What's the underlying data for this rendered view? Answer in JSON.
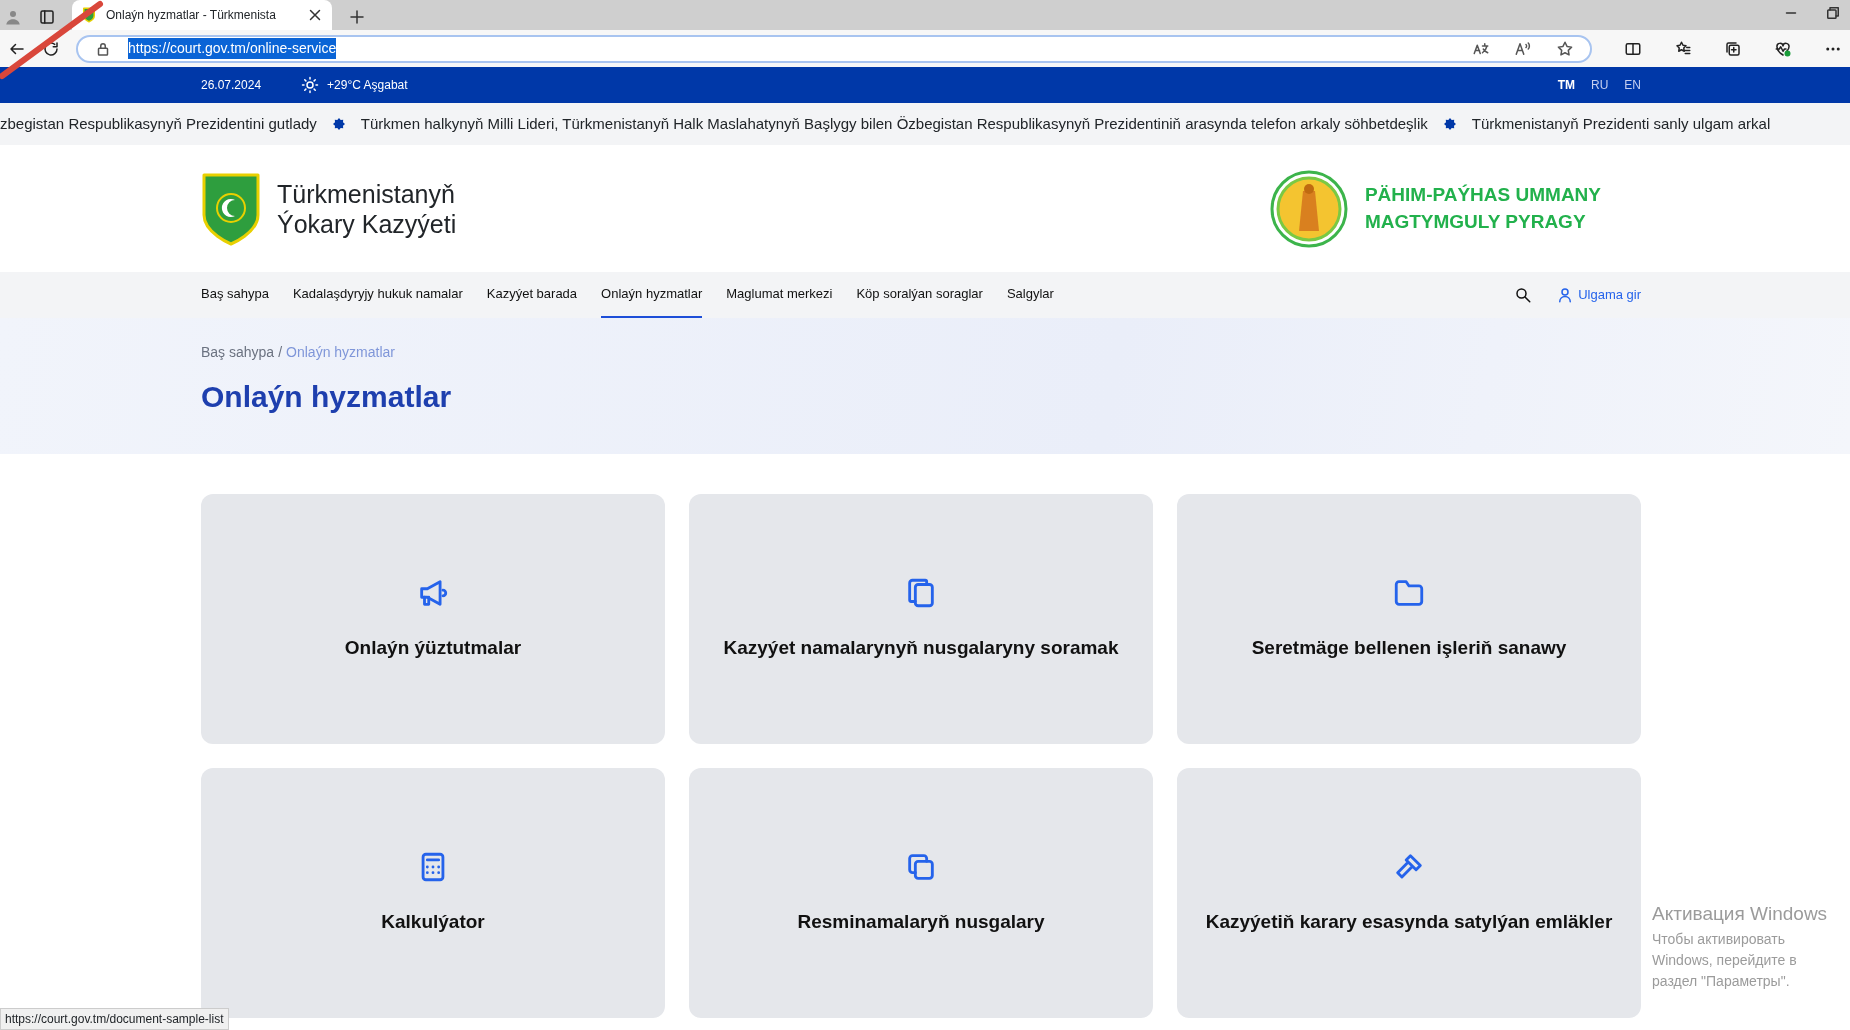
{
  "browser": {
    "tabs": [
      {
        "title": "Onlaýn hyzmatlar - Türkmenista",
        "selected": true
      }
    ],
    "url": "https://court.gov.tm/online-service",
    "url_highlighted": true
  },
  "topbar": {
    "date": "26.07.2024",
    "weather": "+29°C Aşgabat",
    "languages": [
      {
        "label": "TM",
        "selected": true
      },
      {
        "label": "RU",
        "selected": false
      },
      {
        "label": "EN",
        "selected": false
      }
    ]
  },
  "ticker": [
    "zbegistan Respublikasynyň Prezidentini gutlady",
    "Türkmen halkynyň Milli Lideri, Türkmenistanyň Halk Maslahatynyň Başlygy bilen Özbegistan Respublikasynyň Prezidentiniň arasynda telefon arkaly söhbetdeşlik",
    "Türkmenistanyň Prezidenti sanly ulgam arkal"
  ],
  "header": {
    "title_lines": [
      "Türkmenistanyň",
      "Ýokary Kazyýeti"
    ],
    "slogan_lines": [
      "PÄHIM-PAÝHAS UMMANY",
      "MAGTYMGULY PYRAGY"
    ]
  },
  "nav": {
    "items": [
      {
        "label": "Baş sahypa",
        "selected": false
      },
      {
        "label": "Kadalaşdyryjy hukuk namalar",
        "selected": false
      },
      {
        "label": "Kazyýet barada",
        "selected": false
      },
      {
        "label": "Onlaýn hyzmatlar",
        "selected": true
      },
      {
        "label": "Maglumat merkezi",
        "selected": false
      },
      {
        "label": "Köp soralýan soraglar",
        "selected": false
      },
      {
        "label": "Salgylar",
        "selected": false
      }
    ],
    "login": "Ulgama gir"
  },
  "breadcrumb_separator": "/",
  "breadcrumb": [
    {
      "label": "Baş sahypa",
      "current": false
    },
    {
      "label": "Onlaýn hyzmatlar",
      "current": true
    }
  ],
  "page_title": "Onlaýn hyzmatlar",
  "cards": [
    {
      "title": "Onlaýn ýüztutmalar"
    },
    {
      "title": "Kazyýet namalarynyň nusgalaryny soramak"
    },
    {
      "title": "Seretmäge bellenen işleriň sanawy"
    },
    {
      "title": "Kalkulýator"
    },
    {
      "title": "Resminamalaryň nusgalary"
    },
    {
      "title": "Kazyýetiň karary esasynda satylýan emläkler"
    }
  ],
  "status_link": "https://court.gov.tm/document-sample-list",
  "os_notice": {
    "title": "Активация Windows",
    "text": "Чтобы активировать Windows, перейдите в раздел \"Параметры\"."
  }
}
